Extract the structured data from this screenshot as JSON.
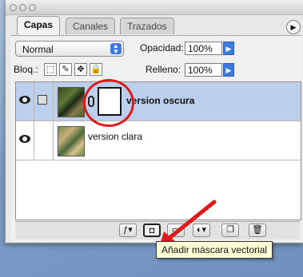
{
  "tabs": [
    {
      "label": "Capas",
      "active": true
    },
    {
      "label": "Canales",
      "active": false
    },
    {
      "label": "Trazados",
      "active": false
    }
  ],
  "blend_mode": {
    "value": "Normal"
  },
  "opacity": {
    "label": "Opacidad:",
    "value": "100%"
  },
  "lock": {
    "label": "Bloq.:"
  },
  "fill": {
    "label": "Relleno:",
    "value": "100%"
  },
  "layers": [
    {
      "name": "version oscura",
      "selected": true,
      "has_mask": true
    },
    {
      "name": "version clara",
      "selected": false,
      "has_mask": false
    }
  ],
  "tooltip": {
    "text": "Añadir máscara vectorial"
  },
  "colors": {
    "selection": "#bcd0ee",
    "annotation_red": "#e01a1a",
    "accent": "#3d7be0"
  },
  "icons": [
    "eye-icon",
    "link-icon",
    "add-layer-style-icon",
    "add-vector-mask-icon",
    "folder-icon",
    "adjustment-layer-icon",
    "new-layer-icon",
    "trash-icon"
  ]
}
